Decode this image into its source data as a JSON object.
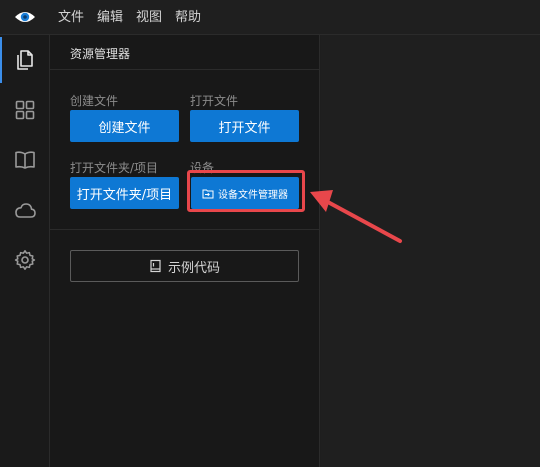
{
  "menubar": {
    "logo_icon": "eye-logo-icon",
    "items": [
      "文件",
      "编辑",
      "视图",
      "帮助"
    ]
  },
  "activitybar": {
    "items": [
      {
        "icon": "files-icon",
        "active": true
      },
      {
        "icon": "extensions-grid-icon",
        "active": false
      },
      {
        "icon": "book-icon",
        "active": false
      },
      {
        "icon": "cloud-icon",
        "active": false
      },
      {
        "icon": "gear-icon",
        "active": false
      }
    ]
  },
  "sidebar": {
    "title": "资源管理器",
    "create_file": {
      "label": "创建文件",
      "button": "创建文件"
    },
    "open_file": {
      "label": "打开文件",
      "button": "打开文件"
    },
    "open_folder": {
      "label": "打开文件夹/项目",
      "button": "打开文件夹/项目"
    },
    "device": {
      "label": "设备",
      "button": "设备文件管理器",
      "icon": "device-folder-icon"
    },
    "sample_code": {
      "button": "示例代码",
      "icon": "book-code-icon"
    }
  },
  "annotation": {
    "highlight_color": "#e8474b",
    "arrow_color": "#e8474b"
  },
  "colors": {
    "accent": "#0e78d4",
    "active_indicator": "#3b8eea"
  }
}
